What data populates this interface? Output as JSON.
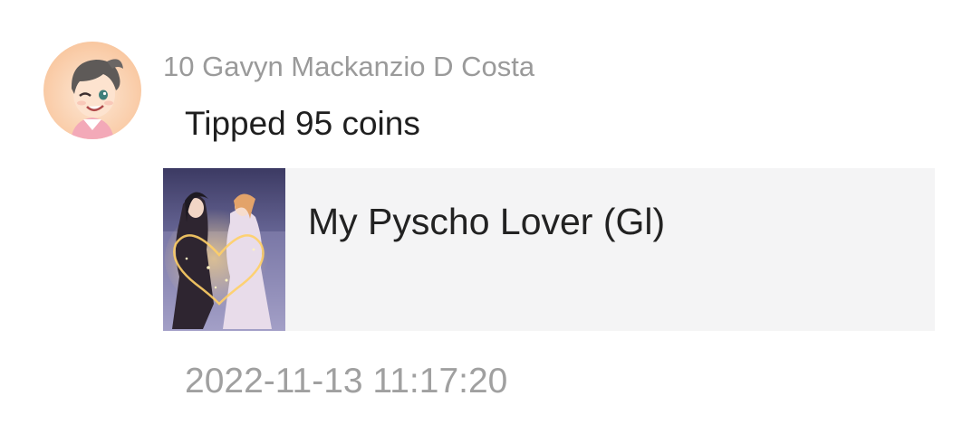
{
  "tip_entry": {
    "username": "10 Gavyn Mackanzio D Costa",
    "message": "Tipped 95 coins",
    "book": {
      "title": "My Pyscho Lover (Gl)"
    },
    "timestamp": "2022-11-13 11:17:20"
  },
  "icons": {
    "avatar": "user-avatar-icon",
    "cover": "book-cover-image"
  },
  "colors": {
    "username": "#9a9a9a",
    "message": "#1f1f1f",
    "card_background": "#f4f4f5",
    "timestamp": "#a0a0a0"
  }
}
